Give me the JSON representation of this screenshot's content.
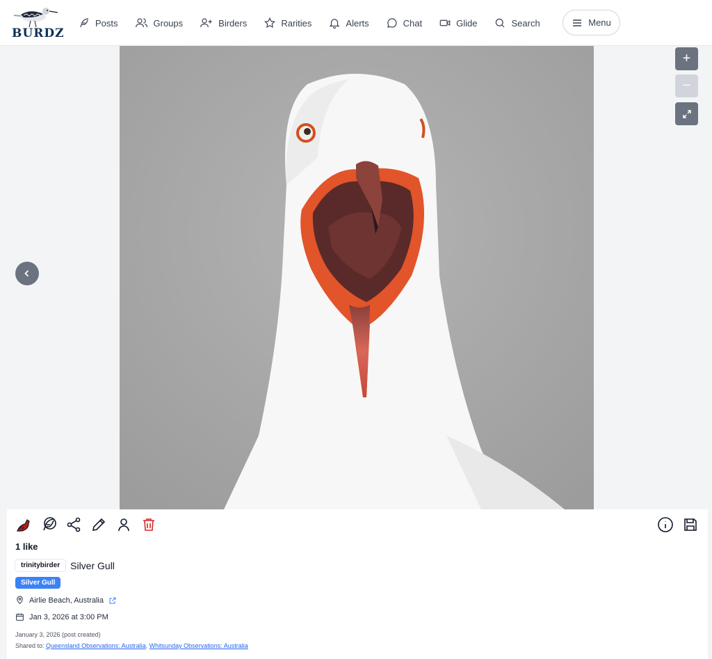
{
  "brand": {
    "name": "BURDZ"
  },
  "nav": {
    "items": [
      {
        "label": "Posts",
        "icon": "feather-icon"
      },
      {
        "label": "Groups",
        "icon": "users-icon"
      },
      {
        "label": "Birders",
        "icon": "user-plus-icon"
      },
      {
        "label": "Rarities",
        "icon": "star-icon"
      },
      {
        "label": "Alerts",
        "icon": "bell-icon"
      },
      {
        "label": "Chat",
        "icon": "chat-bubble-icon"
      },
      {
        "label": "Glide",
        "icon": "video-camera-icon"
      },
      {
        "label": "Search",
        "icon": "search-icon"
      }
    ],
    "menu_label": "Menu"
  },
  "viewer": {
    "zoom_in": "+",
    "zoom_out": "−"
  },
  "post": {
    "likes": "1 like",
    "username": "trinitybirder",
    "caption": "Silver Gull",
    "species_tag": "Silver Gull",
    "location": "Airlie Beach, Australia",
    "observed": "Jan 3, 2026 at 3:00 PM",
    "created": "January 3, 2026 (post created)",
    "shared_prefix": "Shared to:",
    "shared_groups": [
      "Queensland Observations: Australia",
      "Whitsunday Observations: Australia"
    ],
    "shared_separator": ", "
  },
  "colors": {
    "accent": "#3b82f6",
    "like": "#b91c1c",
    "delete": "#dc2626",
    "link": "#2563eb"
  }
}
